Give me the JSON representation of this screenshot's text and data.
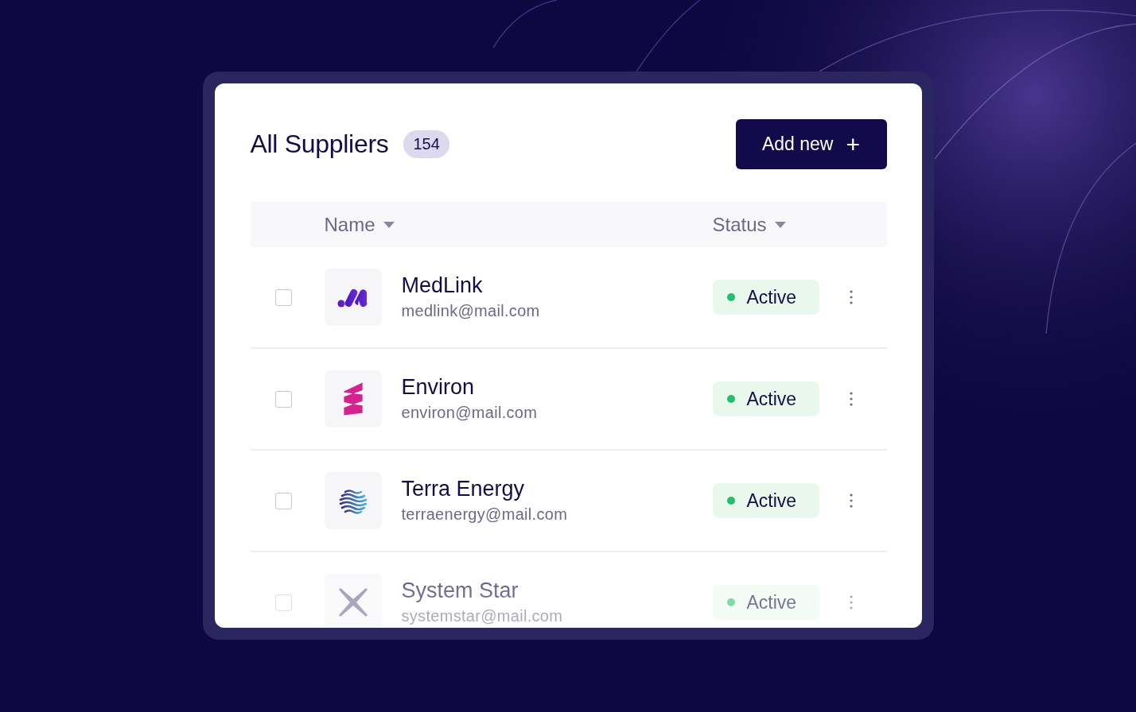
{
  "title": "All Suppliers",
  "count": "154",
  "add_button": {
    "label": "Add new",
    "icon": "+"
  },
  "table": {
    "columns": [
      {
        "label": "Name"
      },
      {
        "label": "Status"
      }
    ],
    "rows": [
      {
        "kind": "medlink",
        "name": "MedLink",
        "email": "medlink@mail.com",
        "status": "Active",
        "checked": false
      },
      {
        "kind": "environ",
        "name": "Environ",
        "email": "environ@mail.com",
        "status": "Active",
        "checked": false
      },
      {
        "kind": "terra",
        "name": "Terra Energy",
        "email": "terraenergy@mail.com",
        "status": "Active",
        "checked": false
      },
      {
        "kind": "star",
        "name": "System Star",
        "email": "systemstar@mail.com",
        "status": "Active",
        "checked": false
      }
    ]
  }
}
